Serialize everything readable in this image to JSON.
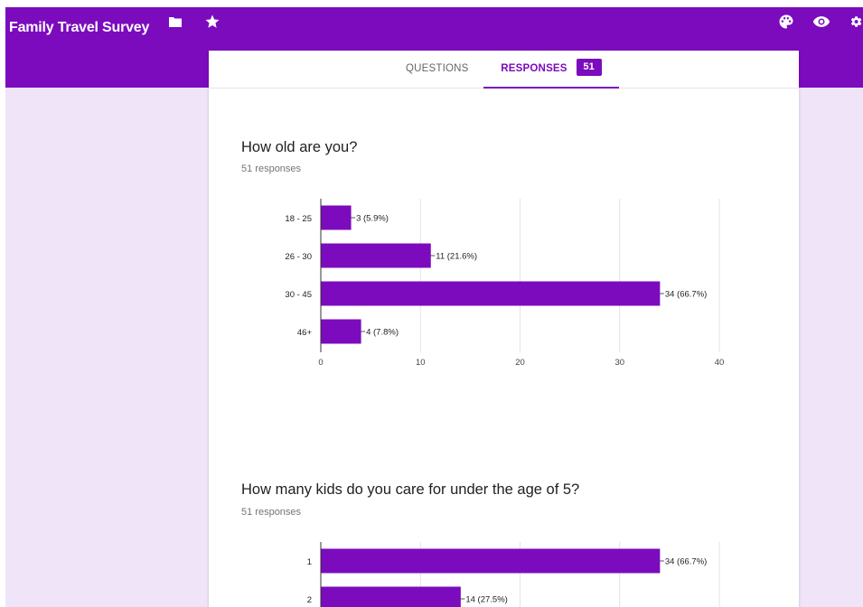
{
  "app": {
    "title": "Family Travel Survey",
    "icons": [
      "folder-icon",
      "star-icon",
      "palette-icon",
      "eye-icon",
      "gear-icon"
    ]
  },
  "tabs": {
    "questions_label": "QUESTIONS",
    "responses_label": "RESPONSES",
    "responses_count": "51"
  },
  "colors": {
    "brand": "#7b0bbd",
    "background": "#efe4f8",
    "bar": "#7b0bbd"
  },
  "questions": [
    {
      "title": "How old are you?",
      "responses_text": "51 responses"
    },
    {
      "title": "How many kids do you care for under the age of 5?",
      "responses_text": "51 responses"
    }
  ],
  "chart_data": [
    {
      "type": "bar",
      "orientation": "horizontal",
      "categories": [
        "18 - 25",
        "26 - 30",
        "30 - 45",
        "46+"
      ],
      "values": [
        3,
        11,
        34,
        4
      ],
      "data_labels": [
        "3 (5.9%)",
        "11 (21.6%)",
        "34 (66.7%)",
        "4 (7.8%)"
      ],
      "xlim": [
        0,
        40
      ],
      "xticks": [
        "0",
        "10",
        "20",
        "30",
        "40"
      ],
      "grid": true
    },
    {
      "type": "bar",
      "orientation": "horizontal",
      "categories": [
        "1",
        "2"
      ],
      "values": [
        34,
        14
      ],
      "data_labels": [
        "34 (66.7%)",
        "14 (27.5%)"
      ],
      "xlim": [
        0,
        40
      ],
      "grid": true
    }
  ]
}
